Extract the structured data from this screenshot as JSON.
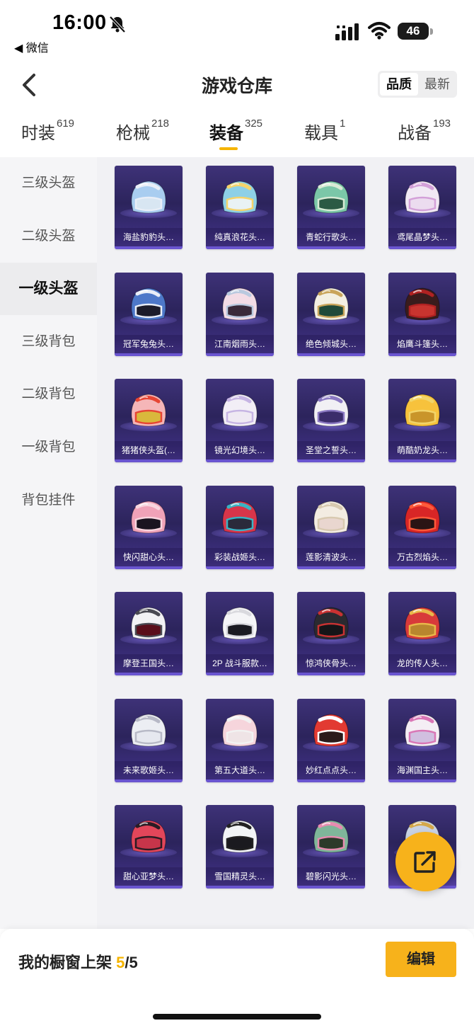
{
  "status_bar": {
    "time": "16:00",
    "back_app": "◀ 微信",
    "battery": "46"
  },
  "header": {
    "title": "游戏仓库",
    "back_icon": "chevron-left-icon",
    "sort": {
      "active": "品质",
      "inactive": "最新"
    }
  },
  "tabs": [
    {
      "label": "时装",
      "count": "619"
    },
    {
      "label": "枪械",
      "count": "218"
    },
    {
      "label": "装备",
      "count": "325"
    },
    {
      "label": "载具",
      "count": "1"
    },
    {
      "label": "战备",
      "count": "193"
    }
  ],
  "active_tab": "装备",
  "sidebar": {
    "items": [
      "三级头盔",
      "二级头盔",
      "一级头盔",
      "三级背包",
      "二级背包",
      "一级背包",
      "背包挂件"
    ],
    "active": "一级头盔"
  },
  "items": [
    {
      "name": "海盐豹豹头…",
      "c1": "#a9cdf0",
      "c2": "#e9eef7",
      "visor": "#d8e6f2"
    },
    {
      "name": "纯真浪花头…",
      "c1": "#8ed0e6",
      "c2": "#f5d36a",
      "visor": "#e9f2f4"
    },
    {
      "name": "青蛇行歌头…",
      "c1": "#7bc7a8",
      "c2": "#d8ead5",
      "visor": "#2b5a44"
    },
    {
      "name": "鸢尾晶梦头…",
      "c1": "#f1e9f4",
      "c2": "#d3a0d8",
      "visor": "#ecdcef"
    },
    {
      "name": "冠军兔兔头…",
      "c1": "#4d78c9",
      "c2": "#e9eef7",
      "visor": "#1c1c2a"
    },
    {
      "name": "江南烟雨头…",
      "c1": "#f3dce6",
      "c2": "#b9c9df",
      "visor": "#3a2a3a"
    },
    {
      "name": "绝色倾城头…",
      "c1": "#f3efe2",
      "c2": "#c9a45a",
      "visor": "#1f4a3a"
    },
    {
      "name": "焰鹰斗篷头…",
      "c1": "#3a1c1c",
      "c2": "#b02222",
      "visor": "#c9342f"
    },
    {
      "name": "猪猪侠头盔(…",
      "c1": "#f5b6b8",
      "c2": "#e64534",
      "visor": "#d9b83c"
    },
    {
      "name": "镜光幻境头…",
      "c1": "#f2eef6",
      "c2": "#c6b4e3",
      "visor": "#efe9f3"
    },
    {
      "name": "圣堂之誓头…",
      "c1": "#f1f0f4",
      "c2": "#8b79c2",
      "visor": "#3b2d6b"
    },
    {
      "name": "萌酷奶龙头…",
      "c1": "#f7c23c",
      "c2": "#f2d56a",
      "visor": "#c9952a"
    },
    {
      "name": "快闪甜心头…",
      "c1": "#f0a2b8",
      "c2": "#f8d5df",
      "visor": "#1a1420"
    },
    {
      "name": "彩装战姬头…",
      "c1": "#d8354a",
      "c2": "#3ab3c4",
      "visor": "#2a2a3a"
    },
    {
      "name": "莲影清波头…",
      "c1": "#f3ece2",
      "c2": "#d8c9b0",
      "visor": "#e9d6cf"
    },
    {
      "name": "万古烈焰头…",
      "c1": "#d82626",
      "c2": "#ff5a3a",
      "visor": "#2a1414"
    },
    {
      "name": "摩登王国头…",
      "c1": "#f2f2f4",
      "c2": "#4a4a52",
      "visor": "#5a0e1a"
    },
    {
      "name": "2P 战斗服款…",
      "c1": "#f5f5f7",
      "c2": "#d9d9de",
      "visor": "#1b1b22"
    },
    {
      "name": "惊鸿侠骨头…",
      "c1": "#2a2a30",
      "c2": "#c93232",
      "visor": "#151518"
    },
    {
      "name": "龙的传人头…",
      "c1": "#d83a3a",
      "c2": "#e9b84a",
      "visor": "#b8862e"
    },
    {
      "name": "未来歌姬头…",
      "c1": "#eceef3",
      "c2": "#b7b9c6",
      "visor": "#e6e8ef"
    },
    {
      "name": "第五大道头…",
      "c1": "#f6d5dc",
      "c2": "#f2f2f2",
      "visor": "#efe4e6"
    },
    {
      "name": "妙红点点头…",
      "c1": "#e23a32",
      "c2": "#ffffff",
      "visor": "#2a1a1a"
    },
    {
      "name": "海渊国主头…",
      "c1": "#f4eef4",
      "c2": "#d976b5",
      "visor": "#d1bfe0"
    },
    {
      "name": "甜心亚梦头…",
      "c1": "#e2465a",
      "c2": "#2a1c24",
      "visor": "#c7354a"
    },
    {
      "name": "雪国精灵头…",
      "c1": "#f2f4f6",
      "c2": "#222222",
      "visor": "#1a1a1f"
    },
    {
      "name": "碧影闪光头…",
      "c1": "#7fb69a",
      "c2": "#e78bb0",
      "visor": "#2b3a2a"
    },
    {
      "name": "",
      "c1": "#c9d2e3",
      "c2": "#d4a84a",
      "visor": "#1d2a3a"
    }
  ],
  "fab_icon": "share-export-icon",
  "bottom": {
    "showcase_label": "我的橱窗上架",
    "current": "5",
    "total": "/5",
    "edit_label": "编辑"
  }
}
